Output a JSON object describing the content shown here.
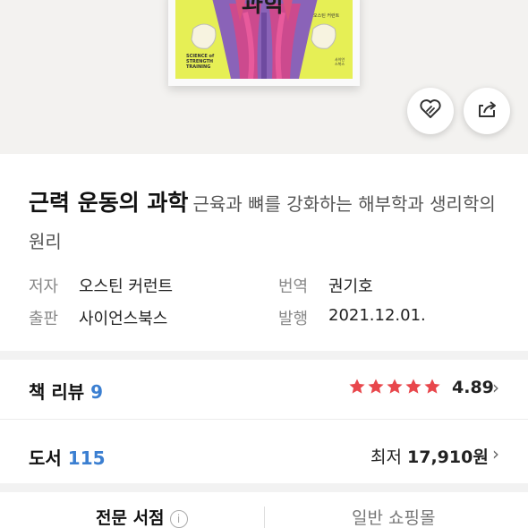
{
  "cover": {
    "title_fragment": "과학",
    "subtitle": "SCIENCE of STRENGTH TRAINING",
    "author": "오스틴 커런트",
    "publisher": "사이언스북스"
  },
  "actions": {
    "like_icon": "heart-icon",
    "share_icon": "share-icon"
  },
  "book": {
    "title": "근력 운동의 과학",
    "subtitle": "근육과 뼈를 강화하는 해부학과 생리학의 원리",
    "author_label": "저자",
    "author": "오스틴 커런트",
    "translator_label": "번역",
    "translator": "권기호",
    "publisher_label": "출판",
    "publisher": "사이언스북스",
    "published_label": "발행",
    "published": "2021.12.01."
  },
  "reviews": {
    "label": "책 리뷰",
    "count": "9",
    "rating": "4.89",
    "stars": 5,
    "star_color": "#e8474c"
  },
  "stores": {
    "label": "도서",
    "count": "115",
    "min_label": "최저",
    "min_price": "17,910원"
  },
  "tabs": {
    "specialty": "전문 서점",
    "general": "일반 쇼핑몰"
  },
  "colors": {
    "accent": "#3b7fd1",
    "cover_bg": "#e6ef55"
  }
}
